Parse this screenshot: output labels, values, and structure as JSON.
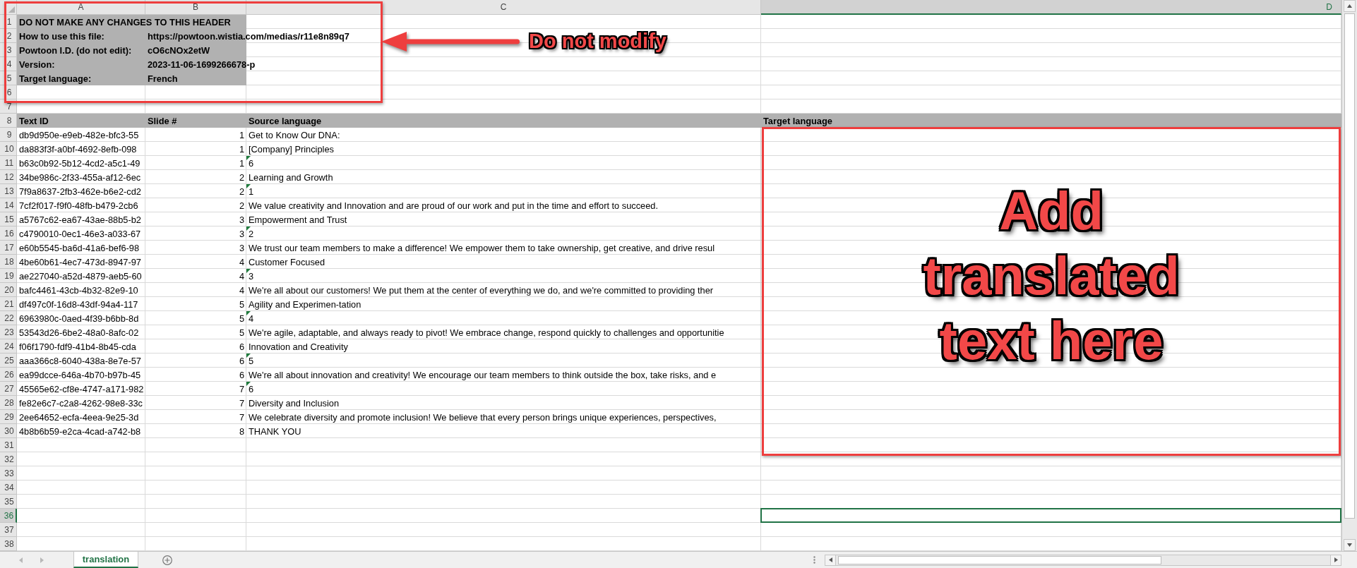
{
  "columns": [
    {
      "label": "A",
      "selected": false
    },
    {
      "label": "B",
      "selected": false
    },
    {
      "label": "C",
      "selected": false
    },
    {
      "label": "D",
      "selected": true
    }
  ],
  "rows": [
    {
      "number": "1",
      "kind": "header",
      "selected": false,
      "cells": [
        "DO NOT MAKE ANY CHANGES TO THIS HEADER"
      ]
    },
    {
      "number": "2",
      "kind": "header",
      "selected": false,
      "cells": [
        "How to use this file:",
        "https://powtoon.wistia.com/medias/r11e8n89q7"
      ]
    },
    {
      "number": "3",
      "kind": "header",
      "selected": false,
      "cells": [
        "Powtoon I.D. (do not edit):",
        "cO6cNOx2etW"
      ]
    },
    {
      "number": "4",
      "kind": "header",
      "selected": false,
      "cells": [
        "Version:",
        "2023-11-06-1699266678-p"
      ]
    },
    {
      "number": "5",
      "kind": "header",
      "selected": false,
      "cells": [
        "Target language:",
        "French"
      ]
    },
    {
      "number": "6",
      "kind": "blank",
      "selected": false
    },
    {
      "number": "7",
      "kind": "blank",
      "selected": false
    },
    {
      "number": "8",
      "kind": "titles",
      "selected": false,
      "cells": [
        "Text ID",
        "Slide #",
        "Source language",
        "Target language"
      ]
    },
    {
      "number": "9",
      "kind": "data",
      "selected": false,
      "flagged": false,
      "cells": [
        "db9d950e-e9eb-482e-bfc3-55",
        "1",
        "Get to Know Our DNA:"
      ]
    },
    {
      "number": "10",
      "kind": "data",
      "selected": false,
      "flagged": false,
      "cells": [
        "da883f3f-a0bf-4692-8efb-098",
        "1",
        "[Company] Principles"
      ]
    },
    {
      "number": "11",
      "kind": "data",
      "selected": false,
      "flagged": true,
      "cells": [
        "b63c0b92-5b12-4cd2-a5c1-49",
        "1",
        "6"
      ]
    },
    {
      "number": "12",
      "kind": "data",
      "selected": false,
      "flagged": false,
      "cells": [
        "34be986c-2f33-455a-af12-6ec",
        "2",
        "Learning and Growth"
      ]
    },
    {
      "number": "13",
      "kind": "data",
      "selected": false,
      "flagged": true,
      "cells": [
        "7f9a8637-2fb3-462e-b6e2-cd2",
        "2",
        "1"
      ]
    },
    {
      "number": "14",
      "kind": "data",
      "selected": false,
      "flagged": false,
      "cells": [
        "7cf2f017-f9f0-48fb-b479-2cb6",
        "2",
        "We value creativity and Innovation and are proud of our work and put in the time and effort to succeed."
      ]
    },
    {
      "number": "15",
      "kind": "data",
      "selected": false,
      "flagged": false,
      "cells": [
        "a5767c62-ea67-43ae-88b5-b2",
        "3",
        "Empowerment and Trust"
      ]
    },
    {
      "number": "16",
      "kind": "data",
      "selected": false,
      "flagged": true,
      "cells": [
        "c4790010-0ec1-46e3-a033-67",
        "3",
        "2"
      ]
    },
    {
      "number": "17",
      "kind": "data",
      "selected": false,
      "flagged": false,
      "cells": [
        "e60b5545-ba6d-41a6-bef6-98",
        "3",
        "We trust our team members to make a difference! We empower them to take ownership, get creative, and drive resul"
      ]
    },
    {
      "number": "18",
      "kind": "data",
      "selected": false,
      "flagged": false,
      "cells": [
        "4be60b61-4ec7-473d-8947-97",
        "4",
        "Customer Focused"
      ]
    },
    {
      "number": "19",
      "kind": "data",
      "selected": false,
      "flagged": true,
      "cells": [
        "ae227040-a52d-4879-aeb5-60",
        "4",
        "3"
      ]
    },
    {
      "number": "20",
      "kind": "data",
      "selected": false,
      "flagged": false,
      "cells": [
        "bafc4461-43cb-4b32-82e9-10",
        "4",
        "We're all about our customers! We put them at the center of everything we do, and we're committed to providing ther"
      ]
    },
    {
      "number": "21",
      "kind": "data",
      "selected": false,
      "flagged": false,
      "cells": [
        "df497c0f-16d8-43df-94a4-117",
        "5",
        "Agility and Experimen-tation"
      ]
    },
    {
      "number": "22",
      "kind": "data",
      "selected": false,
      "flagged": true,
      "cells": [
        "6963980c-0aed-4f39-b6bb-8d",
        "5",
        "4"
      ]
    },
    {
      "number": "23",
      "kind": "data",
      "selected": false,
      "flagged": false,
      "cells": [
        "53543d26-6be2-48a0-8afc-02",
        "5",
        "We're agile, adaptable, and always ready to pivot! We embrace change, respond quickly to challenges and opportunitie"
      ]
    },
    {
      "number": "24",
      "kind": "data",
      "selected": false,
      "flagged": false,
      "cells": [
        "f06f1790-fdf9-41b4-8b45-cda",
        "6",
        "Innovation and Creativity"
      ]
    },
    {
      "number": "25",
      "kind": "data",
      "selected": false,
      "flagged": true,
      "cells": [
        "aaa366c8-6040-438a-8e7e-57",
        "6",
        "5"
      ]
    },
    {
      "number": "26",
      "kind": "data",
      "selected": false,
      "flagged": false,
      "cells": [
        "ea99dcce-646a-4b70-b97b-45",
        "6",
        "We're all about innovation and creativity! We encourage our team members to think outside the box, take risks, and e"
      ]
    },
    {
      "number": "27",
      "kind": "data",
      "selected": false,
      "flagged": true,
      "cells": [
        "45565e62-cf8e-4747-a171-982",
        "7",
        "6"
      ]
    },
    {
      "number": "28",
      "kind": "data",
      "selected": false,
      "flagged": false,
      "cells": [
        "fe82e6c7-c2a8-4262-98e8-33c",
        "7",
        "Diversity and Inclusion"
      ]
    },
    {
      "number": "29",
      "kind": "data",
      "selected": false,
      "flagged": false,
      "cells": [
        "2ee64652-ecfa-4eea-9e25-3d",
        "7",
        "We celebrate diversity and promote inclusion! We believe that every person brings unique experiences, perspectives,"
      ]
    },
    {
      "number": "30",
      "kind": "data",
      "selected": false,
      "flagged": false,
      "cells": [
        "4b8b6b59-e2ca-4cad-a742-b8",
        "8",
        "THANK YOU"
      ]
    },
    {
      "number": "31",
      "kind": "blank",
      "selected": false
    },
    {
      "number": "32",
      "kind": "blank",
      "selected": false
    },
    {
      "number": "33",
      "kind": "blank",
      "selected": false
    },
    {
      "number": "34",
      "kind": "blank",
      "selected": false
    },
    {
      "number": "35",
      "kind": "blank",
      "selected": false
    },
    {
      "number": "36",
      "kind": "blank",
      "selected": true
    },
    {
      "number": "37",
      "kind": "blank",
      "selected": false
    },
    {
      "number": "38",
      "kind": "blank",
      "selected": false
    }
  ],
  "sheet_tabs": [
    {
      "label": "translation",
      "selected": true
    }
  ],
  "annotations": [
    {
      "kind": "arrow_note",
      "text": "Do not modify"
    },
    {
      "kind": "box_note",
      "text": "Add translated text here"
    }
  ]
}
